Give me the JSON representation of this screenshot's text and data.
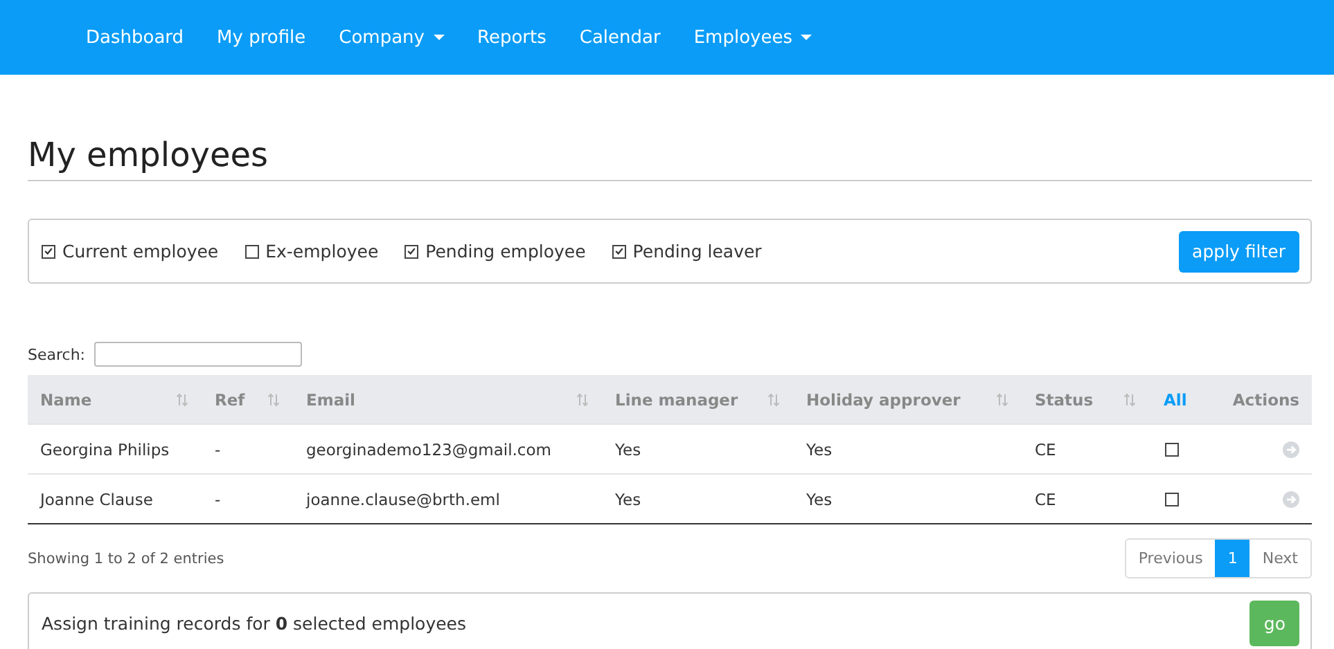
{
  "nav": {
    "items": [
      {
        "label": "Dashboard",
        "dropdown": false
      },
      {
        "label": "My profile",
        "dropdown": false
      },
      {
        "label": "Company",
        "dropdown": true
      },
      {
        "label": "Reports",
        "dropdown": false
      },
      {
        "label": "Calendar",
        "dropdown": false
      },
      {
        "label": "Employees",
        "dropdown": true
      }
    ]
  },
  "page_title": "My employees",
  "filters": [
    {
      "label": "Current employee",
      "checked": true
    },
    {
      "label": "Ex-employee",
      "checked": false
    },
    {
      "label": "Pending employee",
      "checked": true
    },
    {
      "label": "Pending leaver",
      "checked": true
    }
  ],
  "apply_button": "apply filter",
  "search": {
    "label": "Search:"
  },
  "table": {
    "columns": [
      {
        "label": "Name",
        "sortable": true
      },
      {
        "label": "Ref",
        "sortable": true
      },
      {
        "label": "Email",
        "sortable": true
      },
      {
        "label": "Line manager",
        "sortable": true
      },
      {
        "label": "Holiday approver",
        "sortable": true
      },
      {
        "label": "Status",
        "sortable": true
      },
      {
        "label": "All",
        "sortable": false,
        "kind": "link"
      },
      {
        "label": "Actions",
        "sortable": false
      }
    ],
    "rows": [
      {
        "name": "Georgina Philips",
        "ref": "-",
        "email": "georginademo123@gmail.com",
        "line_manager": "Yes",
        "holiday_approver": "Yes",
        "status": "CE",
        "checked": false
      },
      {
        "name": "Joanne Clause",
        "ref": "-",
        "email": "joanne.clause@brth.eml",
        "line_manager": "Yes",
        "holiday_approver": "Yes",
        "status": "CE",
        "checked": false
      }
    ]
  },
  "info": "Showing 1 to 2 of 2 entries",
  "pagination": [
    {
      "label": "Previous",
      "selected": false
    },
    {
      "label": "1",
      "selected": true
    },
    {
      "label": "Next",
      "selected": false
    }
  ],
  "assign": {
    "text": "Assign training records for **0** selected employees",
    "button": "go"
  }
}
